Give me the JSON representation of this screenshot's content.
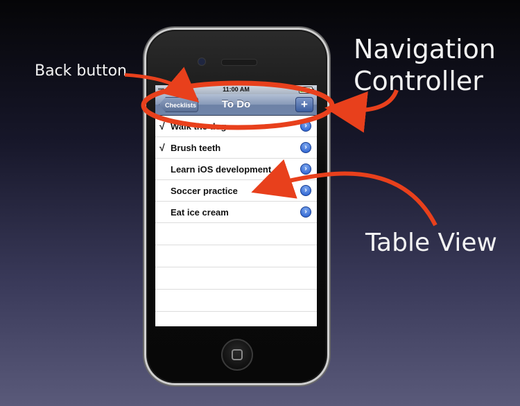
{
  "annotations": {
    "back_button": "Back button",
    "navigation_controller_line1": "Navigation",
    "navigation_controller_line2": "Controller",
    "table_view": "Table View"
  },
  "status_bar": {
    "time": "11:00 AM"
  },
  "nav_bar": {
    "title": "To Do",
    "back_label": "Checklists",
    "add_label": "+"
  },
  "table": {
    "rows": [
      {
        "checked": true,
        "check_mark": "√",
        "label": "Walk the dog"
      },
      {
        "checked": true,
        "check_mark": "√",
        "label": "Brush teeth"
      },
      {
        "checked": false,
        "check_mark": "",
        "label": "Learn iOS development"
      },
      {
        "checked": false,
        "check_mark": "",
        "label": "Soccer practice"
      },
      {
        "checked": false,
        "check_mark": "",
        "label": "Eat ice cream"
      }
    ],
    "disclosure_glyph": "›"
  },
  "colors": {
    "annotation_accent": "#e8401c",
    "nav_bar": "#7487ab",
    "disclosure": "#2f6bd8"
  }
}
